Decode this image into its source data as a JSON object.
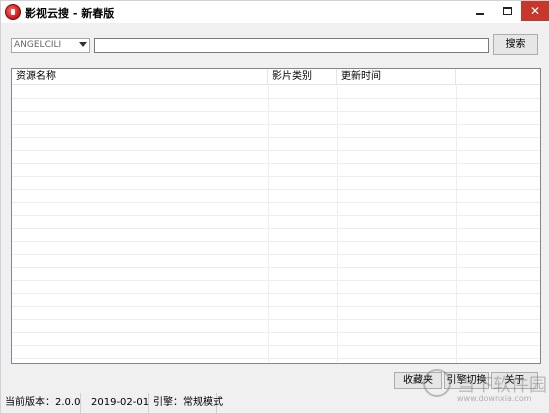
{
  "window": {
    "title": "影视云搜 - 新春版"
  },
  "search": {
    "engine_selected": "ANGELCILI",
    "query_value": "",
    "button_label": "搜索"
  },
  "list": {
    "columns": [
      "资源名称",
      "影片类别",
      "更新时间",
      ""
    ],
    "rows": []
  },
  "actions": {
    "favorites_label": "收藏夹",
    "engine_switch_label": "引擎切换",
    "about_label": "关于"
  },
  "status": {
    "version": "当前版本：2.0.0",
    "date": "2019-02-01",
    "engine_mode": "引擎：常规模式"
  },
  "watermark": {
    "text": "当下软件园",
    "url": "www.downxia.com"
  },
  "colors": {
    "close_button": "#c7372b",
    "window_bg": "#f0f0f0"
  }
}
